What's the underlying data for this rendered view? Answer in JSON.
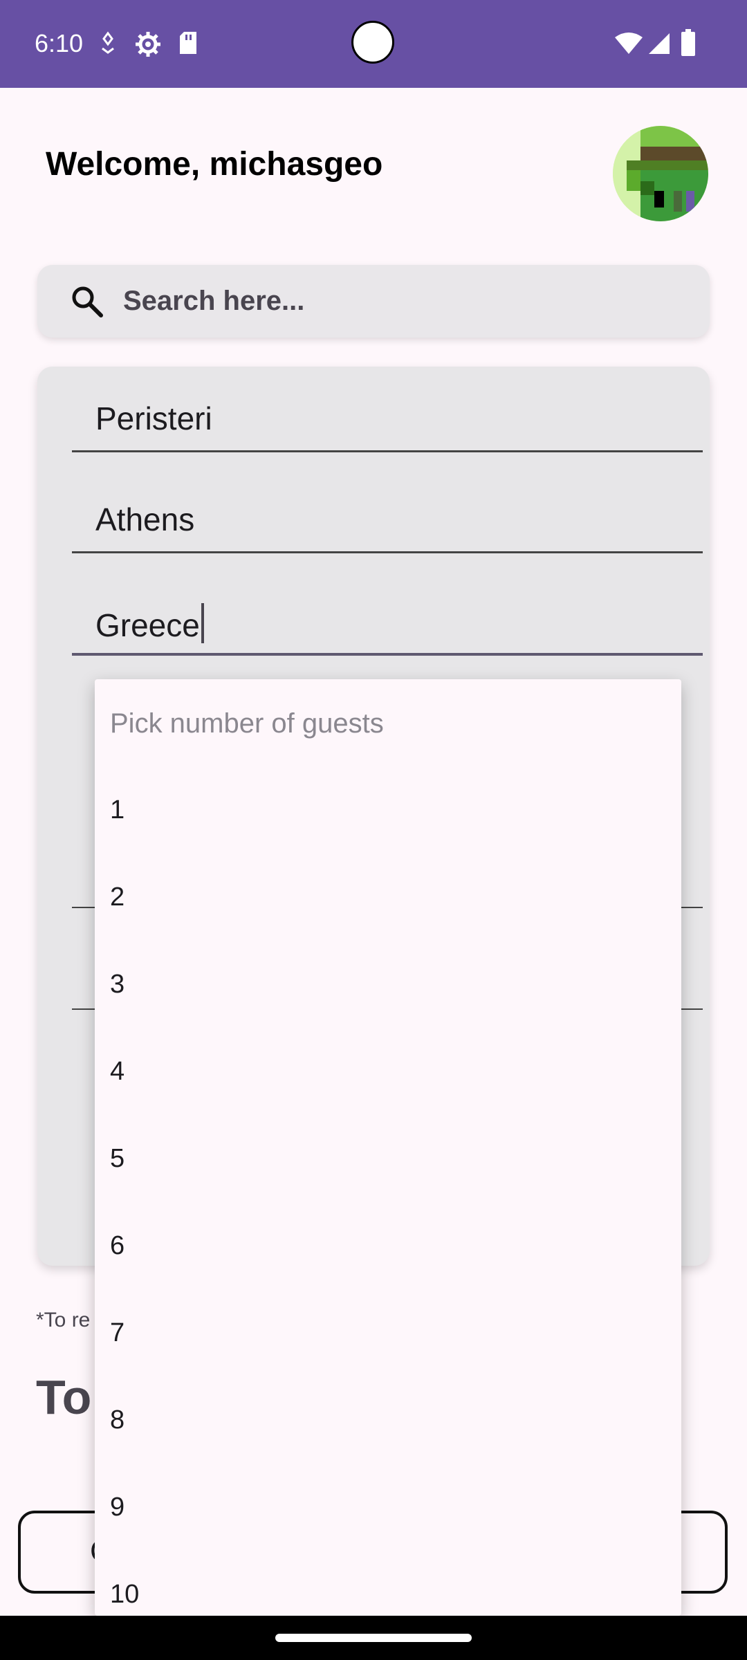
{
  "status_bar": {
    "time": "6:10",
    "icons": [
      "location-icon",
      "settings-icon",
      "sd-card-icon",
      "wifi-icon",
      "signal-icon",
      "battery-icon"
    ]
  },
  "header": {
    "welcome": "Welcome, michasgeo"
  },
  "search": {
    "placeholder": "Search here..."
  },
  "form": {
    "fields": [
      {
        "value": "Peristeri"
      },
      {
        "value": "Athens"
      },
      {
        "value": "Greece"
      }
    ]
  },
  "note_partial": "*To re",
  "heading_partial": "To",
  "bottom_button_partial": "C",
  "dropdown": {
    "hint": "Pick number of guests",
    "options": [
      "1",
      "2",
      "3",
      "4",
      "5",
      "6",
      "7",
      "8",
      "9",
      "10"
    ]
  },
  "colors": {
    "status_bar": "#6750a4",
    "background": "#fef7fb",
    "card": "#e7e6e8"
  }
}
